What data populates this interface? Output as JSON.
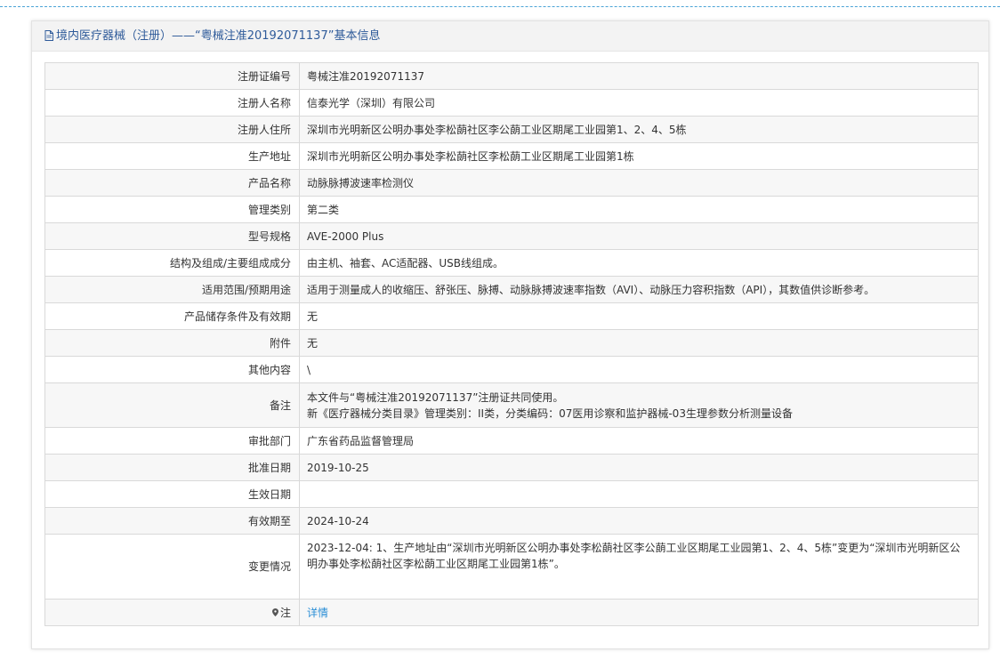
{
  "header": {
    "title": "境内医疗器械（注册）——“粤械注准20192071137”基本信息",
    "icon": "document-icon"
  },
  "rows": [
    {
      "label": "注册证编号",
      "value": "粤械注准20192071137"
    },
    {
      "label": "注册人名称",
      "value": "信泰光学（深圳）有限公司"
    },
    {
      "label": "注册人住所",
      "value": "深圳市光明新区公明办事处李松蓢社区李公蓢工业区期尾工业园第1、2、4、5栋"
    },
    {
      "label": "生产地址",
      "value": "深圳市光明新区公明办事处李松蓢社区李松蓢工业区期尾工业园第1栋"
    },
    {
      "label": "产品名称",
      "value": "动脉脉搏波速率检测仪"
    },
    {
      "label": "管理类别",
      "value": "第二类"
    },
    {
      "label": "型号规格",
      "value": "AVE-2000 Plus"
    },
    {
      "label": "结构及组成/主要组成成分",
      "value": "由主机、袖套、AC适配器、USB线组成。"
    },
    {
      "label": "适用范围/预期用途",
      "value": "适用于测量成人的收缩压、舒张压、脉搏、动脉脉搏波速率指数（AVI）、动脉压力容积指数（API），其数值供诊断参考。"
    },
    {
      "label": "产品储存条件及有效期",
      "value": "无"
    },
    {
      "label": "附件",
      "value": "无"
    },
    {
      "label": "其他内容",
      "value": "\\"
    },
    {
      "label": "备注",
      "value_line1": "本文件与“粤械注准20192071137”注册证共同使用。",
      "value_line2": "新《医疗器械分类目录》管理类别：II类，分类编码：07医用诊察和监护器械-03生理参数分析测量设备"
    },
    {
      "label": "审批部门",
      "value": "广东省药品监督管理局"
    },
    {
      "label": "批准日期",
      "value": "2019-10-25"
    },
    {
      "label": "生效日期",
      "value": ""
    },
    {
      "label": "有效期至",
      "value": "2024-10-24"
    },
    {
      "label": "变更情况",
      "value": "2023-12-04: 1、生产地址由“深圳市光明新区公明办事处李松蓢社区李公蓢工业区期尾工业园第1、2、4、5栋”变更为“深圳市光明新区公明办事处李松蓢社区李松蓢工业区期尾工业园第1栋”。"
    },
    {
      "label": "注",
      "value": "详情",
      "icon": "map-pin-icon"
    }
  ],
  "colors": {
    "header_text": "#2f5b9a",
    "link": "#2a8ed6",
    "top_rule": "#4aa3d6"
  }
}
